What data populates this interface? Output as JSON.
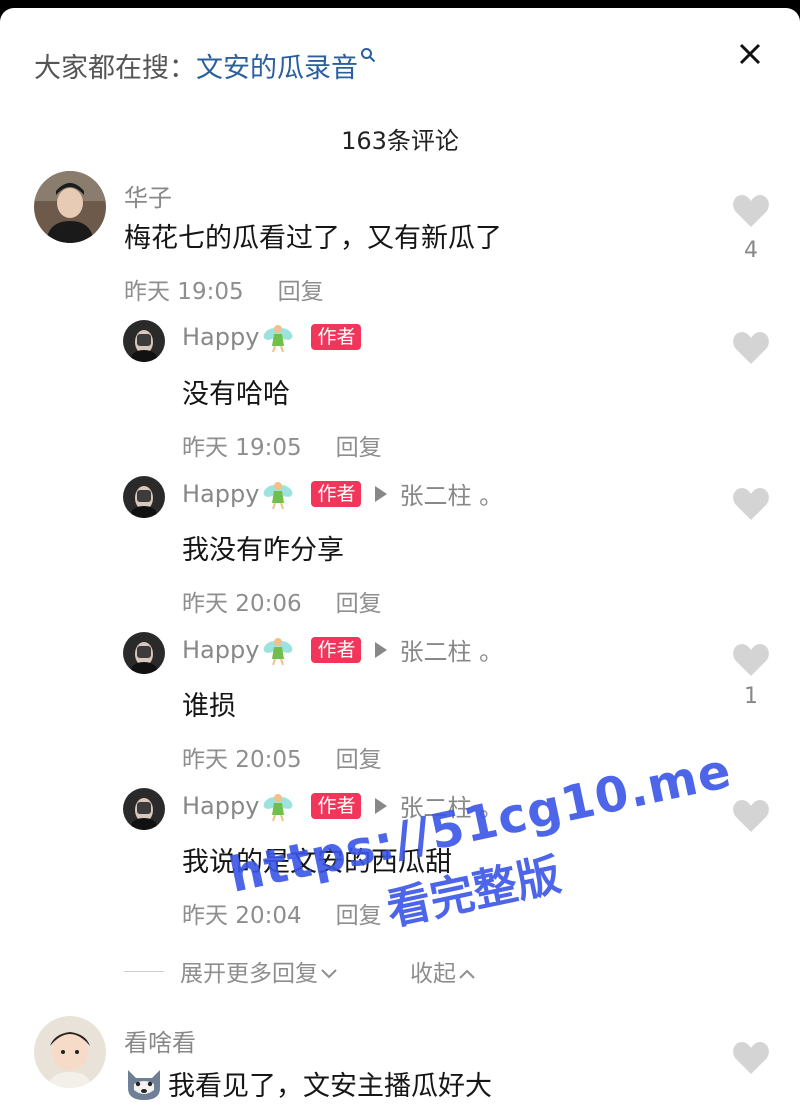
{
  "header": {
    "search_label": "大家都在搜：",
    "search_term": "文安的瓜录音",
    "comment_count": "163条评论"
  },
  "comments": [
    {
      "username": "华子",
      "text": "梅花七的瓜看过了，又有新瓜了",
      "time": "昨天 19:05",
      "reply_label": "回复",
      "likes": "4"
    },
    {
      "username": "Happy",
      "author_badge": "作者",
      "text": "没有哈哈",
      "time": "昨天 19:05",
      "reply_label": "回复"
    },
    {
      "username": "Happy",
      "author_badge": "作者",
      "reply_to": "张二柱 。",
      "text": "我没有咋分享",
      "time": "昨天 20:06",
      "reply_label": "回复"
    },
    {
      "username": "Happy",
      "author_badge": "作者",
      "reply_to": "张二柱 。",
      "text": "谁损",
      "time": "昨天 20:05",
      "reply_label": "回复",
      "likes": "1"
    },
    {
      "username": "Happy",
      "author_badge": "作者",
      "reply_to": "张二柱 。",
      "text": "我说的是文安的西瓜甜",
      "time": "昨天 20:04",
      "reply_label": "回复"
    },
    {
      "username": "看啥看",
      "text": "我看见了，文安主播瓜好大"
    }
  ],
  "thread_controls": {
    "expand_label": "展开更多回复",
    "collapse_label": "收起"
  },
  "watermark": {
    "line1": "https://51cg10.me",
    "line2": "看完整版"
  },
  "colors": {
    "search_term": "#2b5f9e",
    "author_badge": "#f2365b",
    "watermark": "#3a55e6"
  }
}
